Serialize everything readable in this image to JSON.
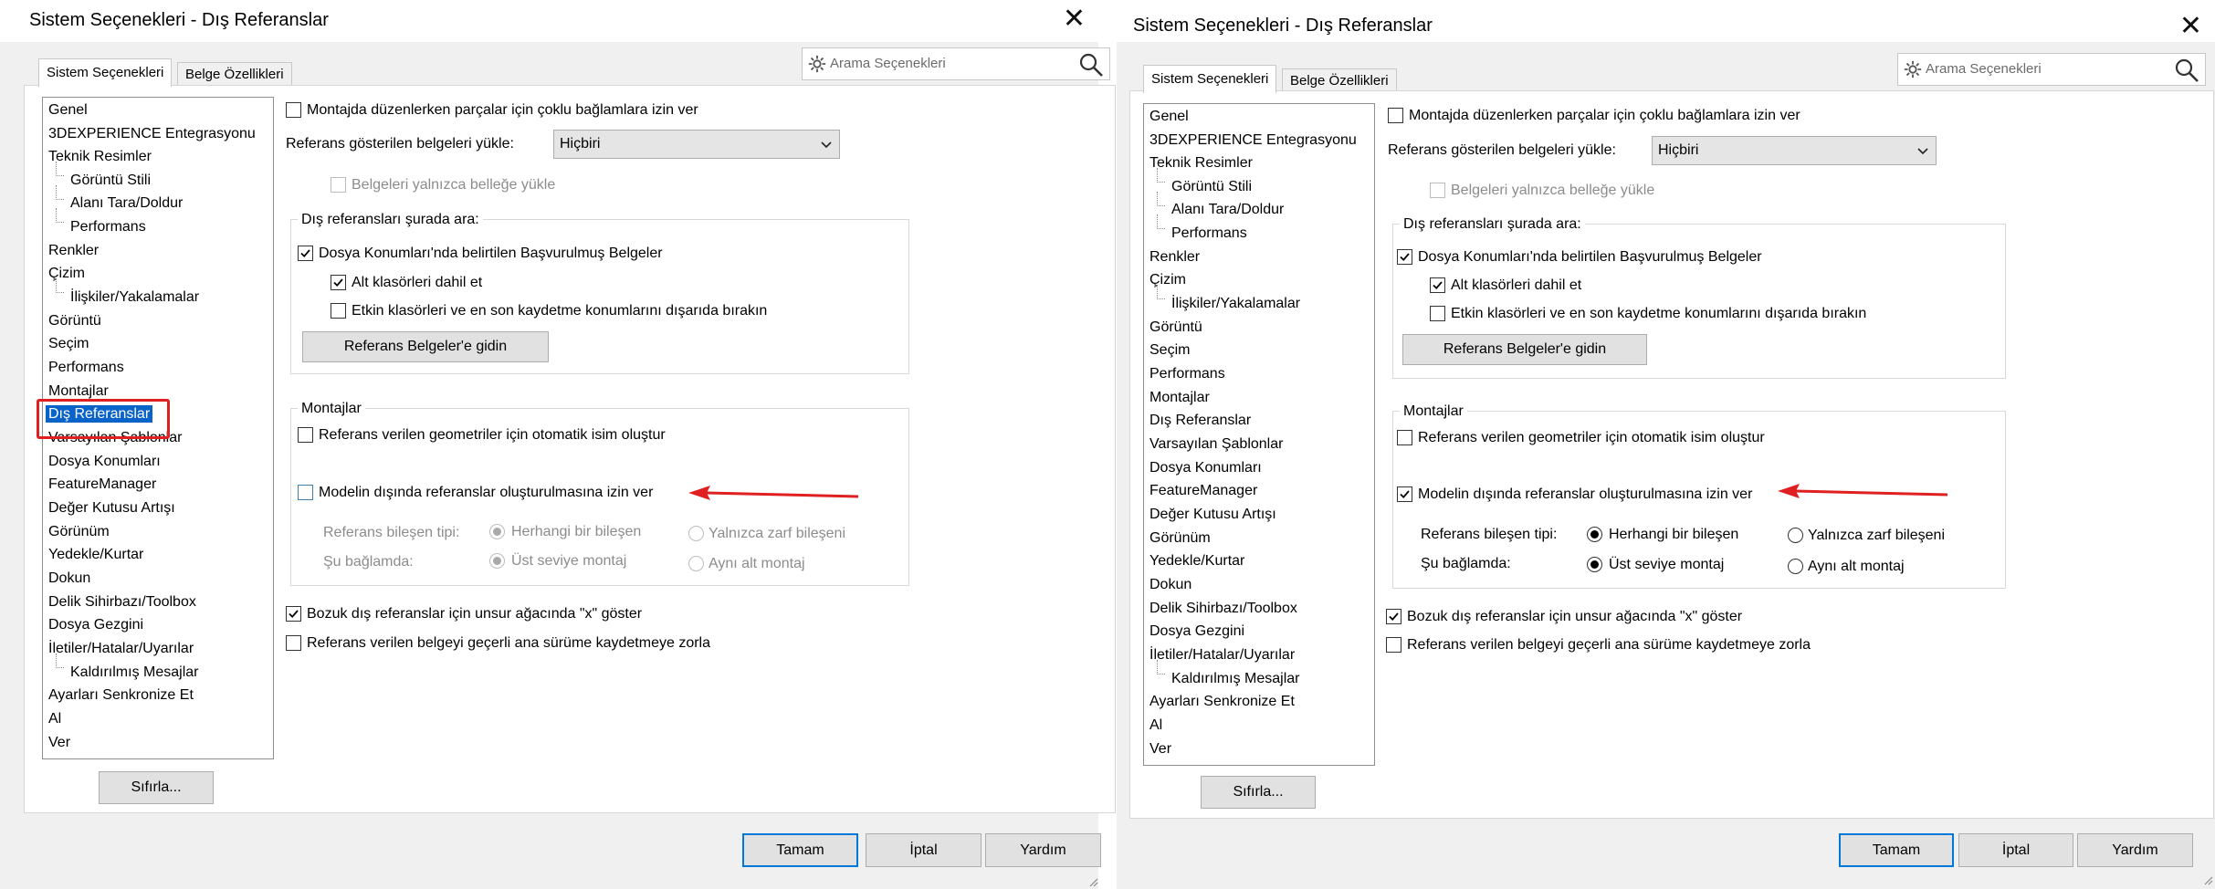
{
  "dialogs": [
    {
      "title": "Sistem Seçenekleri - Dış Referanslar",
      "tabs": [
        "Sistem Seçenekleri",
        "Belge Özellikleri"
      ],
      "search_placeholder": "Arama Seçenekleri",
      "tree_items": [
        "Genel",
        "3DEXPERIENCE Entegrasyonu",
        "Teknik Resimler",
        "Görüntü Stili",
        "Alanı Tara/Doldur",
        "Performans",
        "Renkler",
        "Çizim",
        "İlişkiler/Yakalamalar",
        "Görüntü",
        "Seçim",
        "Performans",
        "Montajlar",
        "Dış Referanslar",
        "Varsayılan Şablonlar",
        "Dosya Konumları",
        "FeatureManager",
        "Değer Kutusu Artışı",
        "Görünüm",
        "Yedekle/Kurtar",
        "Dokun",
        "Delik Sihirbazı/Toolbox",
        "Dosya Gezgini",
        "İletiler/Hatalar/Uyarılar",
        "Kaldırılmış Mesajlar",
        "Ayarları Senkronize Et",
        "Al",
        "Ver"
      ],
      "reset_button": "Sıfırla...",
      "multi_context_label": "Montajda düzenlerken parçalar için çoklu bağlamlara izin ver",
      "load_docs_label": "Referans gösterilen belgeleri yükle:",
      "load_docs_value": "Hiçbiri",
      "memory_only_label": "Belgeleri yalnızca belleğe yükle",
      "search_group_title": "Dış referansları şurada ara:",
      "file_locations_label": "Dosya Konumları'nda belirtilen Başvurulmuş Belgeler",
      "subfolders_label": "Alt klasörleri dahil et",
      "exclude_label": "Etkin klasörleri ve en son kaydetme konumlarını dışarıda bırakın",
      "goto_button": "Referans Belgeler'e gidin",
      "assemblies_group_title": "Montajlar",
      "auto_name_label": "Referans verilen geometriler için otomatik isim oluştur",
      "allow_outside_label": "Modelin dışında referanslar oluşturulmasına izin ver",
      "component_type_label": "Referans bileşen tipi:",
      "any_component": "Herhangi bir bileşen",
      "envelope_only": "Yalnızca zarf bileşeni",
      "context_label": "Şu bağlamda:",
      "top_level": "Üst seviye montaj",
      "same_sub": "Aynı alt montaj",
      "broken_x_label": "Bozuk dış referanslar için unsur ağacında \"x\" göster",
      "force_save_label": "Referans verilen belgeyi geçerli ana sürüme kaydetmeye zorla",
      "ok_button": "Tamam",
      "cancel_button": "İptal",
      "help_button": "Yardım"
    },
    {
      "title": "Sistem Seçenekleri - Dış Referanslar",
      "tabs": [
        "Sistem Seçenekleri",
        "Belge Özellikleri"
      ],
      "search_placeholder": "Arama Seçenekleri",
      "tree_items": [
        "Genel",
        "3DEXPERIENCE Entegrasyonu",
        "Teknik Resimler",
        "Görüntü Stili",
        "Alanı Tara/Doldur",
        "Performans",
        "Renkler",
        "Çizim",
        "İlişkiler/Yakalamalar",
        "Görüntü",
        "Seçim",
        "Performans",
        "Montajlar",
        "Dış Referanslar",
        "Varsayılan Şablonlar",
        "Dosya Konumları",
        "FeatureManager",
        "Değer Kutusu Artışı",
        "Görünüm",
        "Yedekle/Kurtar",
        "Dokun",
        "Delik Sihirbazı/Toolbox",
        "Dosya Gezgini",
        "İletiler/Hatalar/Uyarılar",
        "Kaldırılmış Mesajlar",
        "Ayarları Senkronize Et",
        "Al",
        "Ver"
      ],
      "reset_button": "Sıfırla...",
      "multi_context_label": "Montajda düzenlerken parçalar için çoklu bağlamlara izin ver",
      "load_docs_label": "Referans gösterilen belgeleri yükle:",
      "load_docs_value": "Hiçbiri",
      "memory_only_label": "Belgeleri yalnızca belleğe yükle",
      "search_group_title": "Dış referansları şurada ara:",
      "file_locations_label": "Dosya Konumları'nda belirtilen Başvurulmuş Belgeler",
      "subfolders_label": "Alt klasörleri dahil et",
      "exclude_label": "Etkin klasörleri ve en son kaydetme konumlarını dışarıda bırakın",
      "goto_button": "Referans Belgeler'e gidin",
      "assemblies_group_title": "Montajlar",
      "auto_name_label": "Referans verilen geometriler için otomatik isim oluştur",
      "allow_outside_label": "Modelin dışında referanslar oluşturulmasına izin ver",
      "component_type_label": "Referans bileşen tipi:",
      "any_component": "Herhangi bir bileşen",
      "envelope_only": "Yalnızca zarf bileşeni",
      "context_label": "Şu bağlamda:",
      "top_level": "Üst seviye montaj",
      "same_sub": "Aynı alt montaj",
      "broken_x_label": "Bozuk dış referanslar için unsur ağacında \"x\" göster",
      "force_save_label": "Referans verilen belgeyi geçerli ana sürüme kaydetmeye zorla",
      "ok_button": "Tamam",
      "cancel_button": "İptal",
      "help_button": "Yardım"
    }
  ],
  "state": {
    "left": {
      "selected_item": "Dış Referanslar",
      "highlighted": true,
      "allow_outside_checked": false,
      "radios_enabled": false
    },
    "right": {
      "selected_item": "Dış Referanslar",
      "highlighted": false,
      "allow_outside_checked": true,
      "radios_enabled": true
    }
  },
  "colors": {
    "selection_blue": "#0a63c9",
    "annotation_red": "#e02020",
    "default_button_border": "#0078d7"
  }
}
